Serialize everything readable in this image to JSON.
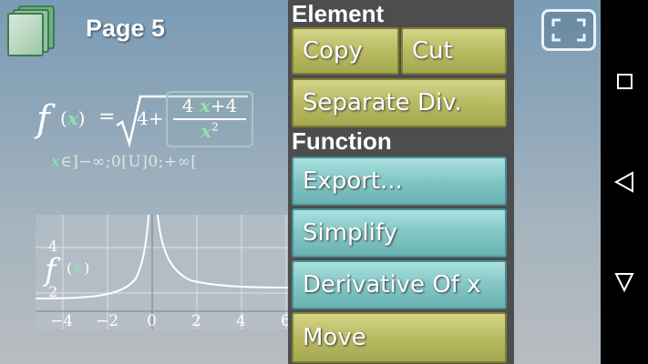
{
  "header": {
    "page_title": "Page 5"
  },
  "formula": {
    "func_letter": "f",
    "var": "x",
    "open_paren": "(",
    "close_paren": ")",
    "equals": "=",
    "radical_term": "4+",
    "numerator_pre": "4",
    "numerator_post": "+4",
    "denominator_power": "2",
    "domain_prefix": "∈]−∞;0[U]0;+∞["
  },
  "graph": {
    "label_letter": "f",
    "x_ticks": [
      "−4",
      "−2",
      "0",
      "2",
      "4",
      "6"
    ],
    "y_ticks": [
      "4",
      "2"
    ]
  },
  "panel": {
    "element_header": "Element",
    "copy_label": "Copy",
    "cut_label": "Cut",
    "separate_label": "Separate Div.",
    "function_header": "Function",
    "export_label": "Export...",
    "simplify_label": "Simplify",
    "derivative_label": "Derivative Of x",
    "move_label": "Move"
  },
  "colors": {
    "olive_button": "#b9bb63",
    "teal_button": "#82c6c5",
    "panel_bg": "#4d4d4d",
    "variable_green": "#8fe6a7"
  },
  "icons": {
    "pages": "pages-stack-icon",
    "fullscreen": "fullscreen-icon",
    "nav_square": "recents-square-icon",
    "nav_back": "back-triangle-icon",
    "nav_down": "home-down-triangle-icon"
  }
}
